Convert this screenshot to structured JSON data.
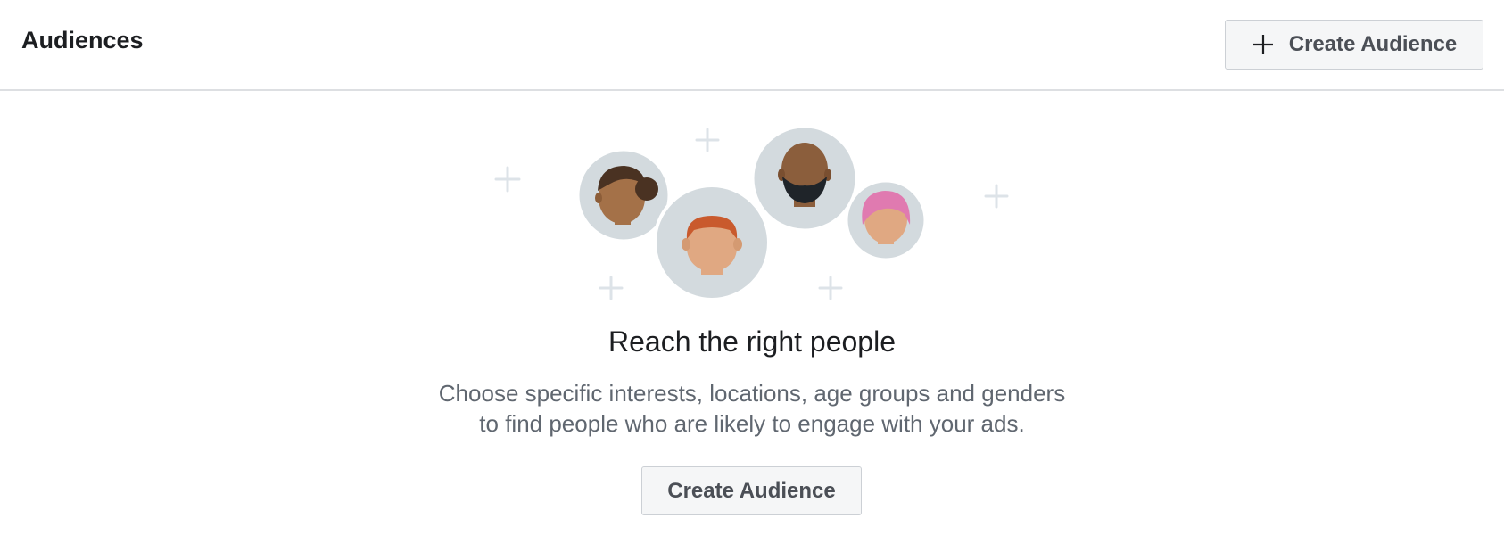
{
  "header": {
    "title": "Audiences",
    "create_button_label": "Create Audience",
    "create_button_icon": "plus-icon"
  },
  "empty_state": {
    "headline": "Reach the right people",
    "description_line1": "Choose specific interests, locations, age groups and genders",
    "description_line2": "to find people who are likely to engage with your ads.",
    "button_label": "Create Audience",
    "illustration_icon": "people-group-icon"
  },
  "colors": {
    "avatar_circle": "#d3dade",
    "sparkle": "#dde3e8",
    "button_bg": "#f5f6f7",
    "button_border": "#ccd0d5",
    "description_text": "#606770",
    "divider": "#dddfe2"
  }
}
